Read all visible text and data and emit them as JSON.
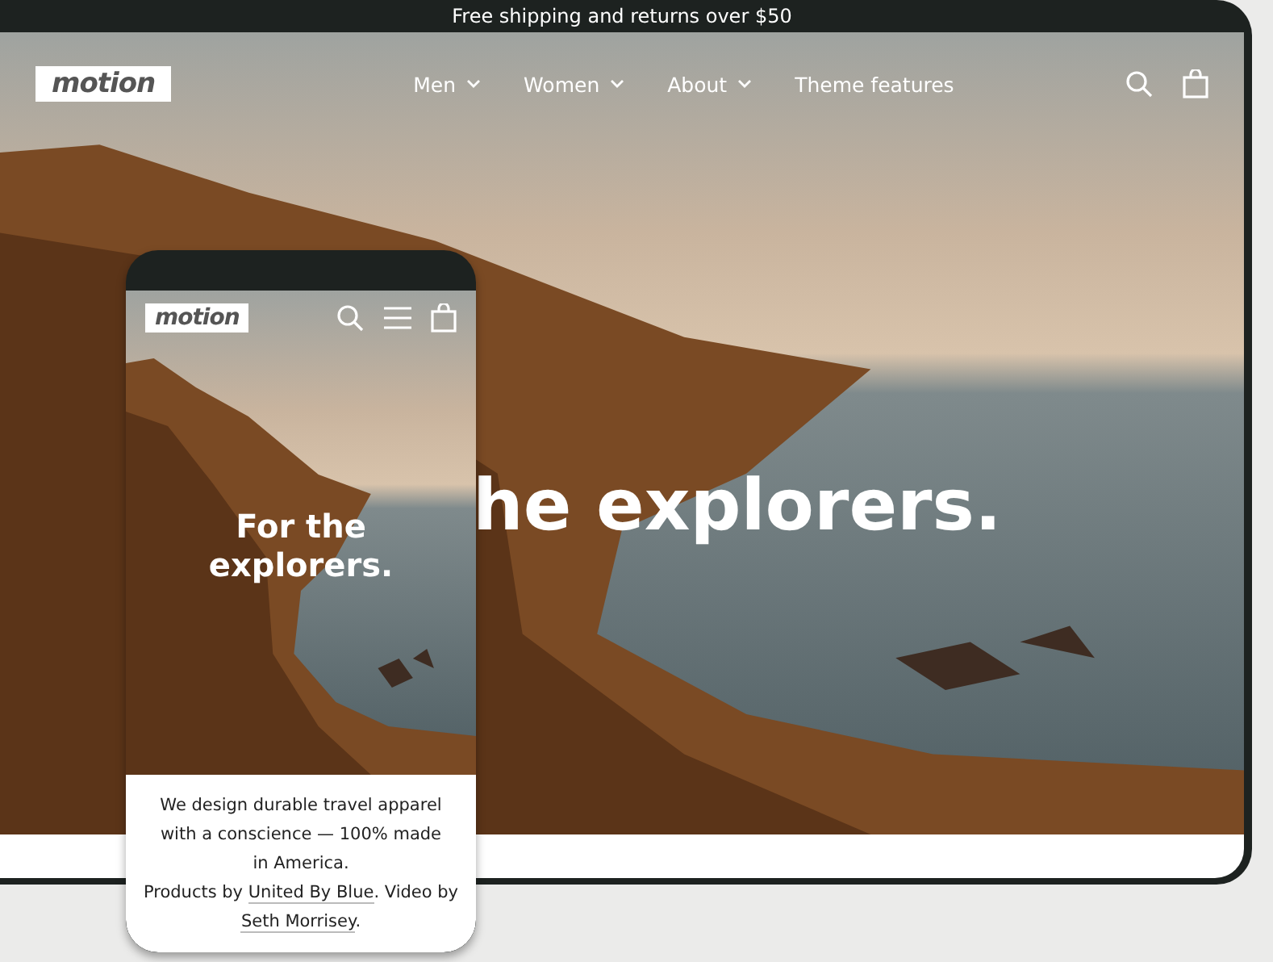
{
  "announcement": "Free shipping and returns over $50",
  "desktop": {
    "logo": "motion",
    "nav": [
      {
        "label": "Men",
        "dropdown": true
      },
      {
        "label": "Women",
        "dropdown": true
      },
      {
        "label": "About",
        "dropdown": true
      },
      {
        "label": "Theme features",
        "dropdown": false
      }
    ],
    "hero_heading": "he explorers."
  },
  "phone": {
    "logo": "motion",
    "hero_heading": "For the explorers.",
    "caption": "We design durable travel apparel with a conscience — 100% made in America.",
    "credits": [
      {
        "kind": "text",
        "text": "Products by"
      },
      {
        "kind": "link",
        "text": "United By Blue"
      },
      {
        "kind": "text",
        "text": ". Video by"
      },
      {
        "kind": "link",
        "text": "Seth Morrisey"
      },
      {
        "kind": "text",
        "text": "."
      }
    ]
  }
}
